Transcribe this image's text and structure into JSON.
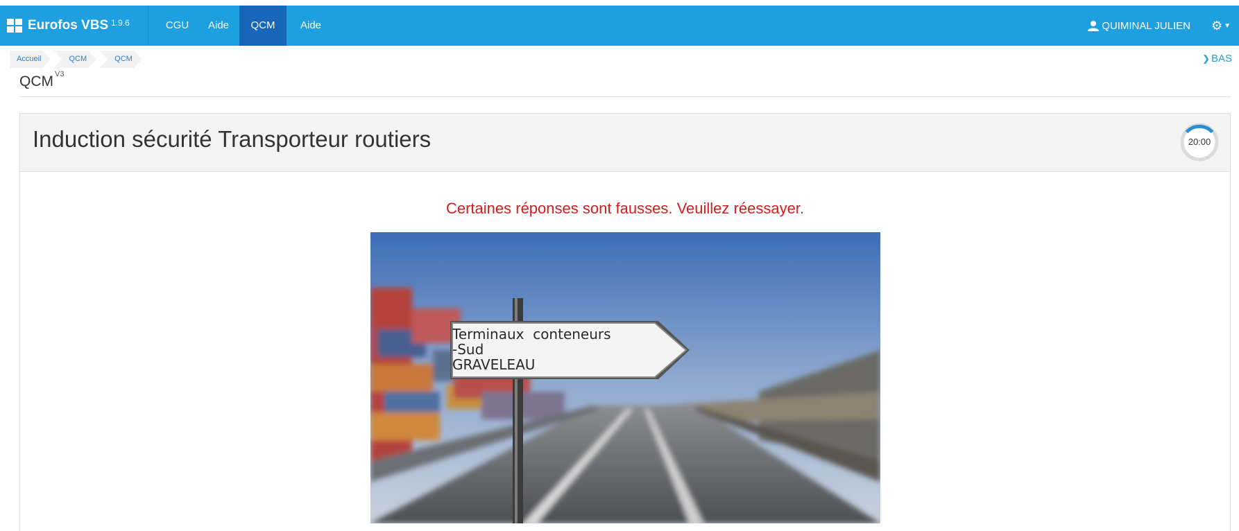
{
  "app": {
    "name": "Eurofos VBS",
    "version": "1.9.6"
  },
  "nav": {
    "items": [
      {
        "label": "CGU",
        "active": false
      },
      {
        "label": "Aide",
        "active": false
      },
      {
        "label": "QCM",
        "active": true
      },
      {
        "label": "Aide",
        "active": false
      }
    ],
    "user_name": "QUIMINAL JULIEN",
    "user_icon": "user-icon",
    "settings_icon": "gear-icon"
  },
  "breadcrumb": {
    "items": [
      "Accueil",
      "QCM",
      "QCM"
    ]
  },
  "scroll_link": {
    "label": "BAS",
    "icon": "chevron-down-icon"
  },
  "page": {
    "title": "QCM",
    "version": "V3"
  },
  "quiz": {
    "title": "Induction sécurité Transporteur routiers",
    "timer": "20:00",
    "error_message": "Certaines réponses sont fausses. Veuillez réessayer.",
    "image": {
      "sign_lines": [
        "Terminaux  conteneurs",
        "-Sud",
        "GRAVELEAU"
      ]
    }
  },
  "colors": {
    "navbar": "#1e9fe0",
    "nav_active": "#1766b9",
    "error": "#d61d1d",
    "link": "#2a7fc6"
  }
}
